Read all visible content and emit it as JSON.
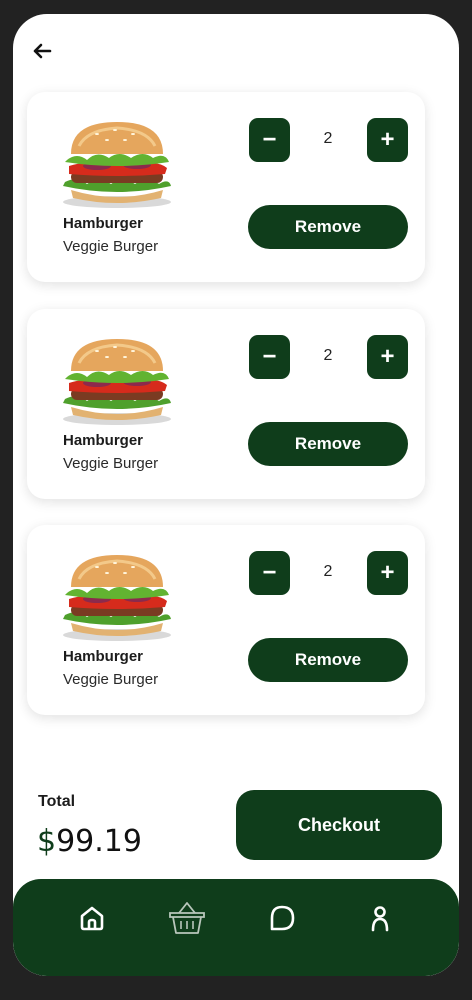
{
  "cart": {
    "items": [
      {
        "name": "Hamburger",
        "variant": "Veggie Burger",
        "quantity": "2",
        "minus_label": "−",
        "plus_label": "+",
        "remove_label": "Remove"
      },
      {
        "name": "Hamburger",
        "variant": "Veggie Burger",
        "quantity": "2",
        "minus_label": "−",
        "plus_label": "+",
        "remove_label": "Remove"
      },
      {
        "name": "Hamburger",
        "variant": "Veggie Burger",
        "quantity": "2",
        "minus_label": "−",
        "plus_label": "+",
        "remove_label": "Remove"
      }
    ]
  },
  "summary": {
    "total_label": "Total",
    "currency": "$",
    "total_value": "99.19",
    "checkout_label": "Checkout"
  },
  "nav": {
    "items": [
      "home-icon",
      "basket-icon",
      "chat-icon",
      "profile-icon"
    ],
    "active": "home-icon"
  },
  "colors": {
    "accent": "#0f3d1b",
    "background": "#ffffff",
    "frame": "#222222"
  }
}
